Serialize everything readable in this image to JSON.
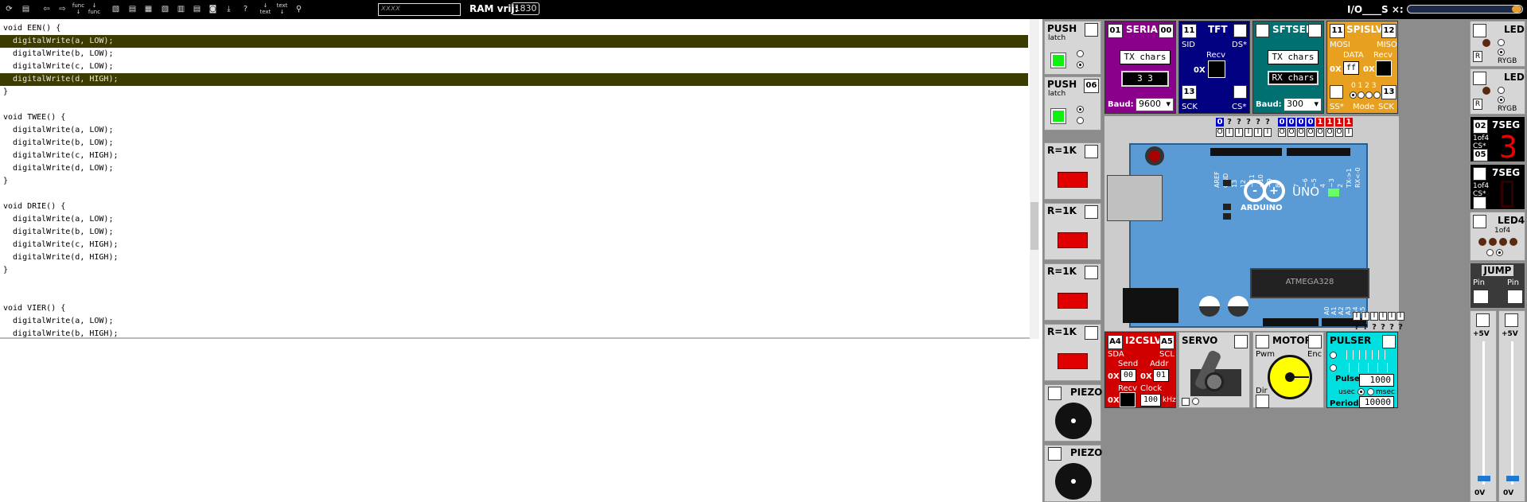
{
  "toolbar": {
    "icons": [
      "open-file",
      "save",
      "undo",
      "redo",
      "step-into-func",
      "step-out-func",
      "view-1",
      "view-2",
      "view-3",
      "view-4",
      "view-5",
      "view-6",
      "view-7",
      "download",
      "help",
      "step-text",
      "step-text-2",
      "binoculars-search"
    ],
    "func_label": "func",
    "text_label": "text",
    "search_placeholder": "xxxx",
    "ram_label": "RAM vrij:",
    "ram_value": "1830",
    "io_label": "I/O____S ×:"
  },
  "code": {
    "lines": [
      "void EEN() {",
      "  digitalWrite(a, LOW);",
      "  digitalWrite(b, LOW);",
      "  digitalWrite(c, LOW);",
      "  digitalWrite(d, HIGH);",
      "}",
      "",
      "void TWEE() {",
      "  digitalWrite(a, LOW);",
      "  digitalWrite(b, LOW);",
      "  digitalWrite(c, HIGH);",
      "  digitalWrite(d, LOW);",
      "}",
      "",
      "void DRIE() {",
      "  digitalWrite(a, LOW);",
      "  digitalWrite(b, LOW);",
      "  digitalWrite(c, HIGH);",
      "  digitalWrite(d, HIGH);",
      "}",
      "",
      "",
      "void VIER() {",
      "  digitalWrite(a, LOW);",
      "  digitalWrite(b, HIGH);"
    ],
    "highlighted": [
      1,
      4
    ]
  },
  "left_devices": {
    "push1": {
      "title": "PUSH",
      "sub": "latch",
      "pin": ""
    },
    "push2": {
      "title": "PUSH",
      "sub": "latch",
      "pin": "06"
    },
    "r1": {
      "title": "R=1K"
    },
    "r2": {
      "title": "R=1K"
    },
    "r3": {
      "title": "R=1K"
    },
    "r4": {
      "title": "R=1K"
    },
    "piezo1": {
      "title": "PIEZO"
    },
    "piezo2": {
      "title": "PIEZO"
    }
  },
  "serial": {
    "title": "SERIAL",
    "pin_left": "01",
    "pin_right": "00",
    "tx": "TX chars",
    "display": "3 3",
    "baud_label": "Baud:",
    "baud": "9600"
  },
  "tft": {
    "title": "TFT",
    "pin": "11",
    "sid": "SID",
    "ds": "DS*",
    "recv": "Recv",
    "ox": "0X",
    "pin2": "13",
    "sck": "SCK",
    "cs": "CS*"
  },
  "sftser": {
    "title": "SFTSER",
    "tx": "TX chars",
    "rx": "RX chars",
    "baud_label": "Baud:",
    "baud": "300"
  },
  "spislv": {
    "title": "SPISLV",
    "pin_left": "11",
    "pin_right": "12",
    "mosi": "MOSI",
    "miso": "MISO",
    "data": "DATA",
    "recv": "Recv",
    "ox": "0X",
    "data_val": "ff",
    "ox2": "0X",
    "modes": "0 1 2 3",
    "ss": "SS*",
    "mode": "Mode",
    "pin2": "13",
    "sck": "SCK"
  },
  "board": {
    "name": "UNO",
    "brand": "ARDUINO",
    "chip": "ATMEGA328",
    "top_pin_labels": [
      "AREF",
      "GND",
      "13",
      "12",
      "~11",
      "~10",
      "~9",
      "8",
      "7",
      "~6",
      "~5",
      "4",
      "~3",
      "2",
      "TX->1",
      "RX<-0"
    ],
    "analog_labels": [
      "A0",
      "A1",
      "A2",
      "A3",
      "A4",
      "A5"
    ],
    "top_pins_state": [
      "0",
      "?",
      "?",
      "?",
      "?",
      "?",
      "0",
      "0",
      "0",
      "0",
      "1",
      "1",
      "1",
      "1"
    ],
    "top_pins_io": [
      "O",
      "I",
      "I",
      "I",
      "I",
      "I",
      "O",
      "O",
      "O",
      "O",
      "O",
      "O",
      "O",
      "I"
    ],
    "bottom_pins_io": [
      "I",
      "I",
      "I",
      "I",
      "I",
      "I"
    ],
    "bottom_pins_state": [
      "?",
      "?",
      "?",
      "?",
      "?",
      "?"
    ]
  },
  "right_devices": {
    "led1": {
      "title": "LED",
      "color": "RYGB",
      "r": "R"
    },
    "led2": {
      "title": "LED",
      "color": "RYGB",
      "r": "R"
    },
    "seg1": {
      "title": "7SEG",
      "pin": "02",
      "sub": "1of4",
      "cs": "CS*",
      "pin2": "05",
      "digit": "3"
    },
    "seg2": {
      "title": "7SEG",
      "sub": "1of4",
      "cs": "CS*"
    },
    "led4": {
      "title": "LED4",
      "sub": "1of4"
    },
    "jump": {
      "title": "JUMP",
      "pin1": "Pin",
      "pin2": "Pin"
    },
    "pot1": {
      "top": "+5V",
      "bottom": "0V"
    },
    "pot2": {
      "top": "+5V",
      "bottom": "0V"
    }
  },
  "i2c": {
    "title": "I2CSLV",
    "pin_left": "A4",
    "pin_right": "A5",
    "sda": "SDA",
    "scl": "SCL",
    "send": "Send",
    "addr": "Addr",
    "ox": "0X",
    "send_val": "00",
    "ox2": "0X",
    "addr_val": "01",
    "recv": "Recv",
    "clock": "Clock",
    "ox3": "0X",
    "clock_val": "100",
    "khz": "kHz"
  },
  "servo": {
    "title": "SERVO"
  },
  "motor": {
    "title": "MOTOR",
    "pwm": "Pwm",
    "enc": "Enc",
    "dir": "Dir"
  },
  "pulser": {
    "title": "PULSER",
    "pulse": "Pulse",
    "pulse_val": "1000",
    "usec": "usec",
    "msec": "msec",
    "period": "Period",
    "period_val": "10000"
  },
  "colors": {
    "highlight": "#3c3c00",
    "serial": "#8b008b",
    "tft": "#000080",
    "sftser": "#007070",
    "spislv": "#e8a020",
    "i2c": "#d00000",
    "pulser": "#00e0e0",
    "board": "#5b9bd5"
  }
}
